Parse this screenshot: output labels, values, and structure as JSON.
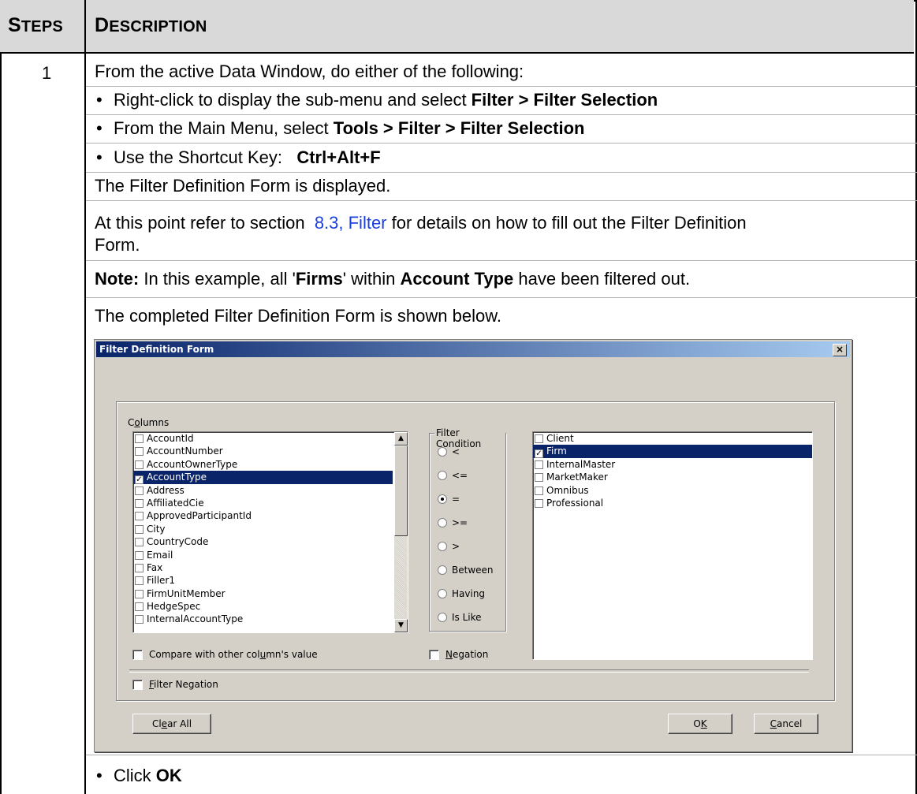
{
  "table": {
    "header_steps_first": "S",
    "header_steps_rest": "TEPS",
    "header_desc_first": "D",
    "header_desc_rest": "ESCRIPTION",
    "step_number": "1"
  },
  "content": {
    "intro": "From the active Data Window, do either of the following:",
    "bullet1_text": "Right-click to display the sub-menu and select ",
    "bullet1_bold": "Filter > Filter Selection",
    "bullet2_text": "From the Main Menu, select ",
    "bullet2_bold": "Tools > Filter > Filter Selection",
    "bullet3_text": "Use the Shortcut Key:   ",
    "bullet3_bold": "Ctrl+Alt+F",
    "displayed": "The Filter Definition Form is displayed.",
    "refer_pre": "At this point refer to section  ",
    "refer_link": "8.3,  Filter",
    "refer_post": " for details on how to fill out the Filter Definition",
    "refer_cont": "Form.",
    "note_label": "Note:",
    "note_mid1": " In this example, all '",
    "note_firms": "Firms",
    "note_mid2": "' within ",
    "note_account_type": "Account Type",
    "note_end": " have been filtered out.",
    "completed": "The completed Filter Definition Form is shown below.",
    "final_bullet_text": "Click ",
    "final_bullet_bold": "OK",
    "bullet_char": "•"
  },
  "dialog": {
    "title": "Filter Definition Form",
    "close_glyph": "×",
    "columns_label_pre": "C",
    "columns_label_u": "o",
    "columns_label_post": "lumns",
    "columns": [
      {
        "name": "AccountId",
        "checked": false
      },
      {
        "name": "AccountNumber",
        "checked": false
      },
      {
        "name": "AccountOwnerType",
        "checked": false
      },
      {
        "name": "AccountType",
        "checked": true
      },
      {
        "name": "Address",
        "checked": false
      },
      {
        "name": "AffiliatedCie",
        "checked": false
      },
      {
        "name": "ApprovedParticipantId",
        "checked": false
      },
      {
        "name": "City",
        "checked": false
      },
      {
        "name": "CountryCode",
        "checked": false
      },
      {
        "name": "Email",
        "checked": false
      },
      {
        "name": "Fax",
        "checked": false
      },
      {
        "name": "Filler1",
        "checked": false
      },
      {
        "name": "FirmUnitMember",
        "checked": false
      },
      {
        "name": "HedgeSpec",
        "checked": false
      },
      {
        "name": "InternalAccountType",
        "checked": false
      }
    ],
    "filter_condition_label": "Filter Condition",
    "conditions": [
      {
        "label": "<",
        "selected": false
      },
      {
        "label": "<=",
        "selected": false
      },
      {
        "label": "=",
        "selected": true
      },
      {
        "label": ">=",
        "selected": false
      },
      {
        "label": ">",
        "selected": false
      },
      {
        "label": "Between",
        "selected": false
      },
      {
        "label": "Having",
        "selected": false
      },
      {
        "label": "Is Like",
        "selected": false
      }
    ],
    "values": [
      {
        "name": "Client",
        "checked": false
      },
      {
        "name": "Firm",
        "checked": true
      },
      {
        "name": "InternalMaster",
        "checked": false
      },
      {
        "name": "MarketMaker",
        "checked": false
      },
      {
        "name": "Omnibus",
        "checked": false
      },
      {
        "name": "Professional",
        "checked": false
      }
    ],
    "compare_pre": "Compare with other col",
    "compare_u": "u",
    "compare_post": "mn's value",
    "negation_u": "N",
    "negation_post": "egation",
    "filter_neg_u": "F",
    "filter_neg_post": "ilter Negation",
    "clear_pre": "Cl",
    "clear_u": "e",
    "clear_post": "ar All",
    "ok_pre": "O",
    "ok_u": "K",
    "cancel_u": "C",
    "cancel_post": "ancel",
    "selection_color": "#0a246a"
  }
}
